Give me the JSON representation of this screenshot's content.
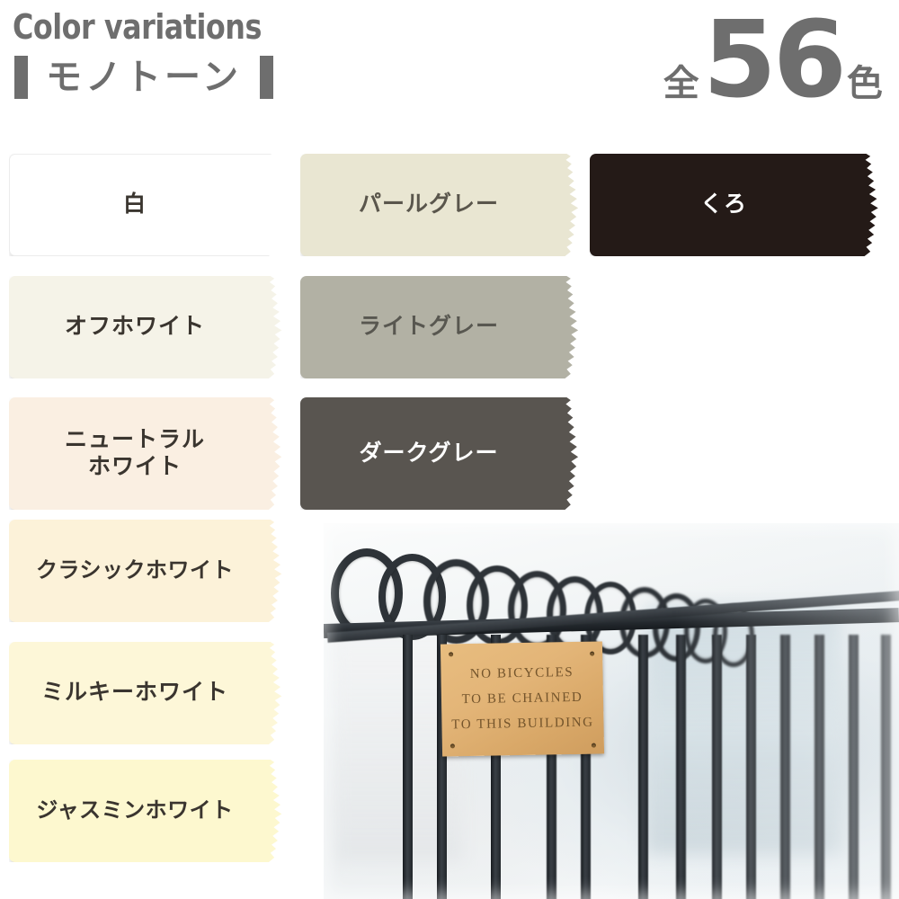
{
  "header": {
    "title_en": "Color variations",
    "subtitle_jp": "モノトーン",
    "count_prefix": "全",
    "count_number": "56",
    "count_suffix": "色",
    "accent_gray": "#6e6e6e"
  },
  "swatches": [
    {
      "name": "白",
      "color": "#ffffff",
      "text_color": "#3a352f",
      "column": 0,
      "row": 0,
      "label_size": "normal"
    },
    {
      "name": "オフホワイト",
      "color": "#f5f3e8",
      "text_color": "#3a352f",
      "column": 0,
      "row": 1,
      "label_size": "normal"
    },
    {
      "name": "ニュートラル\nホワイト",
      "color": "#faefe2",
      "text_color": "#3a352f",
      "column": 0,
      "row": 2,
      "label_size": "normal"
    },
    {
      "name": "クラシックホワイト",
      "color": "#fcf2d9",
      "text_color": "#3a352f",
      "column": 0,
      "row": 3,
      "label_size": "small"
    },
    {
      "name": "ミルキーホワイト",
      "color": "#fdf7d8",
      "text_color": "#3a352f",
      "column": 0,
      "row": 4,
      "label_size": "normal"
    },
    {
      "name": "ジャスミンホワイト",
      "color": "#fdf8cf",
      "text_color": "#3a352f",
      "column": 0,
      "row": 5,
      "label_size": "small"
    },
    {
      "name": "パールグレー",
      "color": "#e9e6d2",
      "text_color": "#5a564c",
      "column": 1,
      "row": 0,
      "label_size": "normal"
    },
    {
      "name": "ライトグレー",
      "color": "#b2b1a4",
      "text_color": "#585750",
      "column": 1,
      "row": 1,
      "label_size": "normal"
    },
    {
      "name": "ダークグレー",
      "color": "#595550",
      "text_color": "#ffffff",
      "column": 1,
      "row": 2,
      "label_size": "normal"
    },
    {
      "name": "くろ",
      "color": "#241a17",
      "text_color": "#ffffff",
      "column": 2,
      "row": 0,
      "label_size": "normal"
    }
  ],
  "photo": {
    "alt_description": "黒い鉄柵と真鍮のプレート",
    "plaque_lines": [
      "NO BICYCLES",
      "TO BE CHAINED",
      "TO THIS BUILDING"
    ],
    "fence_color": "#23282d",
    "plaque_color": "#e3b578"
  }
}
